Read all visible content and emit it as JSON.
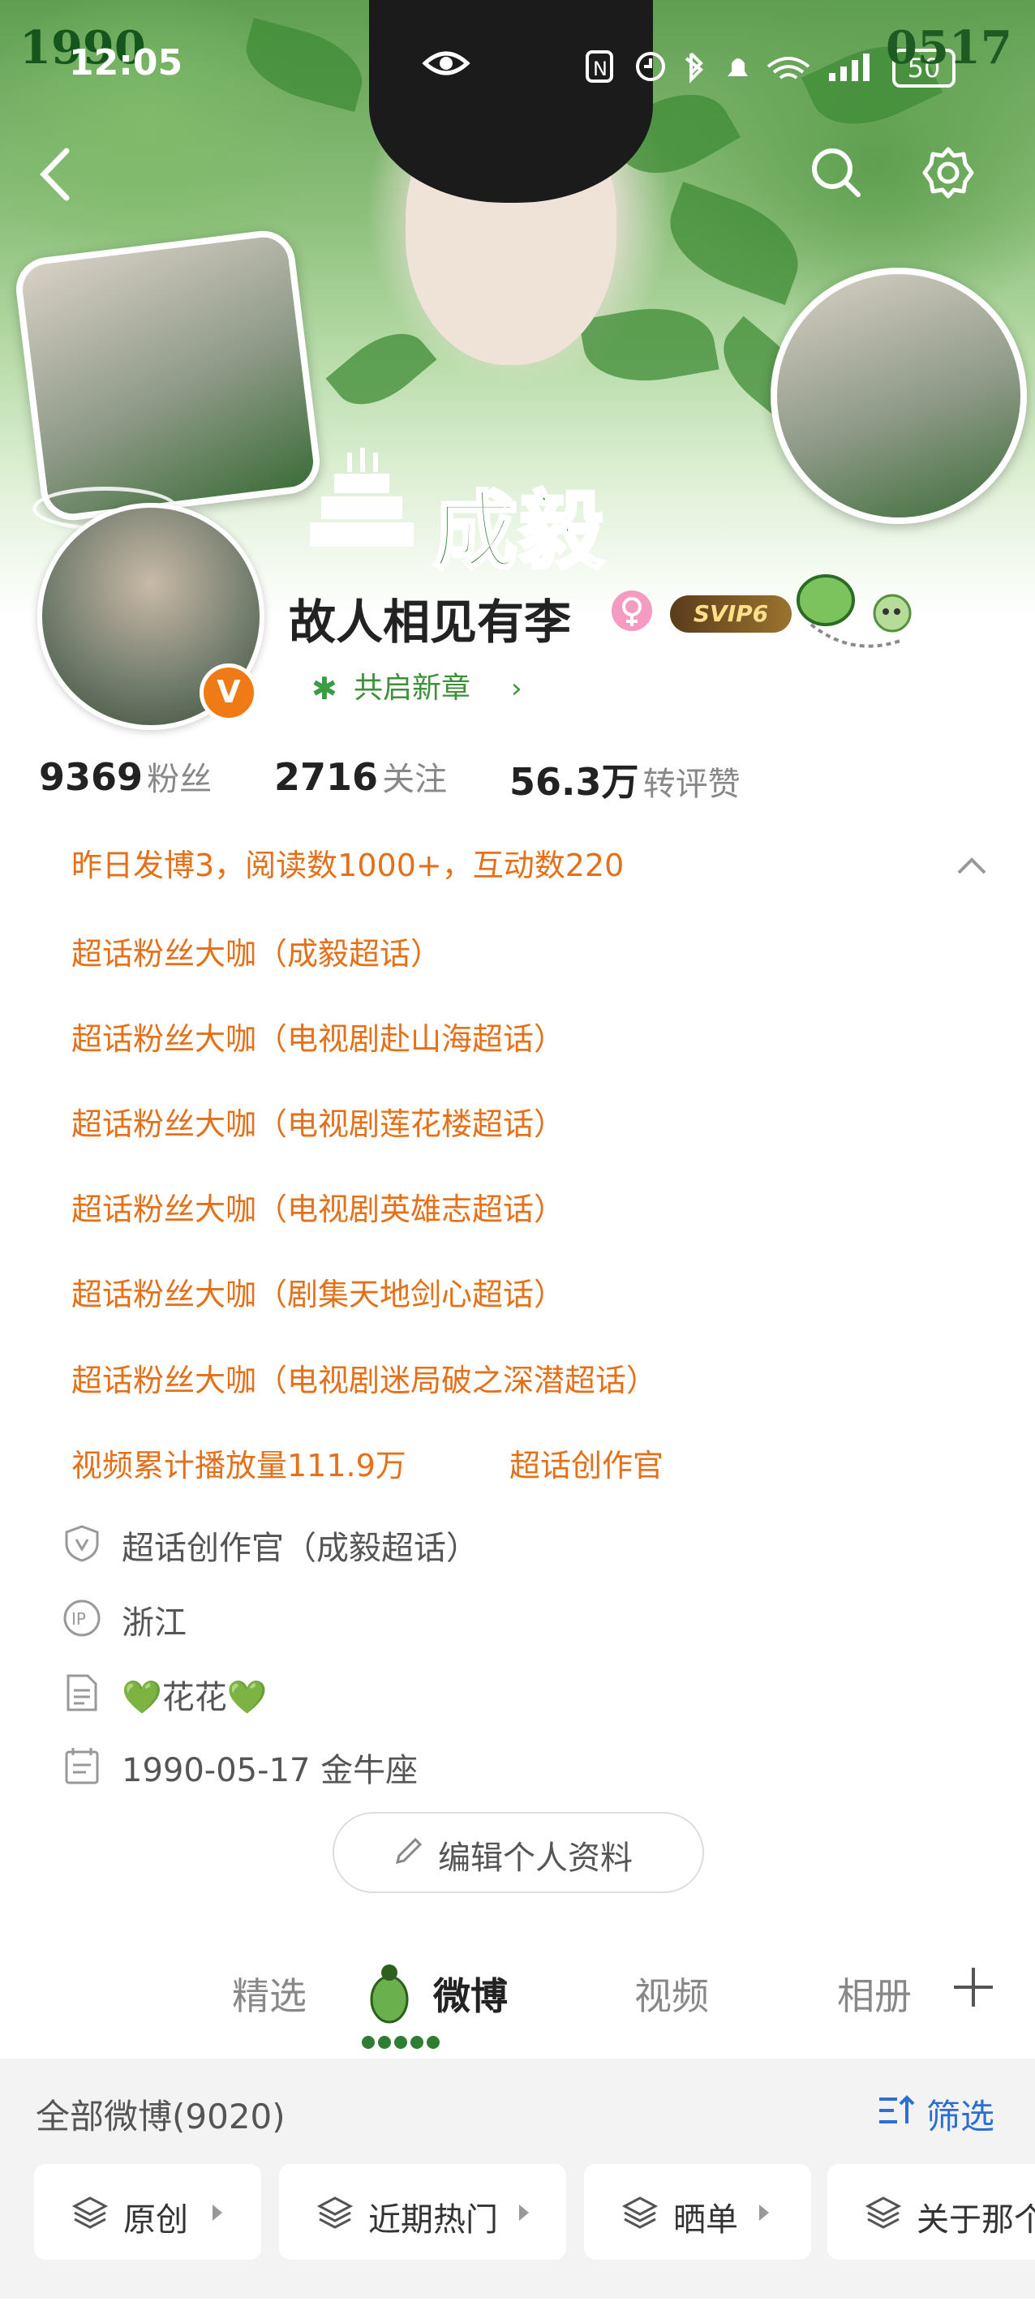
{
  "status_bar": {
    "time": "12:05",
    "battery": "50",
    "overlay_year": "1990",
    "overlay_date": "0517"
  },
  "banner": {
    "title": "成毅"
  },
  "profile": {
    "username": "故人相见有李",
    "vip_badge": "SVIP6",
    "verified_badge": "V",
    "chapter_pill": "共启新章",
    "stats": [
      {
        "value": "9369",
        "label": "粉丝"
      },
      {
        "value": "2716",
        "label": "关注"
      },
      {
        "value": "56.3万",
        "label": "转评赞"
      }
    ],
    "daily_summary": "昨日发博3，阅读数1000+，互动数220"
  },
  "honors": [
    "超话粉丝大咖（成毅超话）",
    "超话粉丝大咖（电视剧赴山海超话）",
    "超话粉丝大咖（电视剧莲花楼超话）",
    "超话粉丝大咖（电视剧英雄志超话）",
    "超话粉丝大咖（剧集天地剑心超话）",
    "超话粉丝大咖（电视剧迷局破之深潜超话）"
  ],
  "video_stats": {
    "plays": "视频累计播放量111.9万",
    "creator": "超话创作官"
  },
  "info": {
    "creator_role": "超话创作官（成毅超话）",
    "ip_location": "浙江",
    "bio": "💚花花💚",
    "birthday": "1990-05-17 金牛座"
  },
  "edit_button": "编辑个人资料",
  "tabs": [
    "精选",
    "微博",
    "视频",
    "相册"
  ],
  "feed": {
    "all_label": "全部微博(9020)",
    "filter_label": "筛选",
    "chips": [
      "原创",
      "近期热门",
      "晒单",
      "关于那个"
    ]
  },
  "colors": {
    "accent_orange": "#e4701a",
    "brand_green": "#2f7d2c",
    "filter_blue": "#2c6fd1"
  }
}
